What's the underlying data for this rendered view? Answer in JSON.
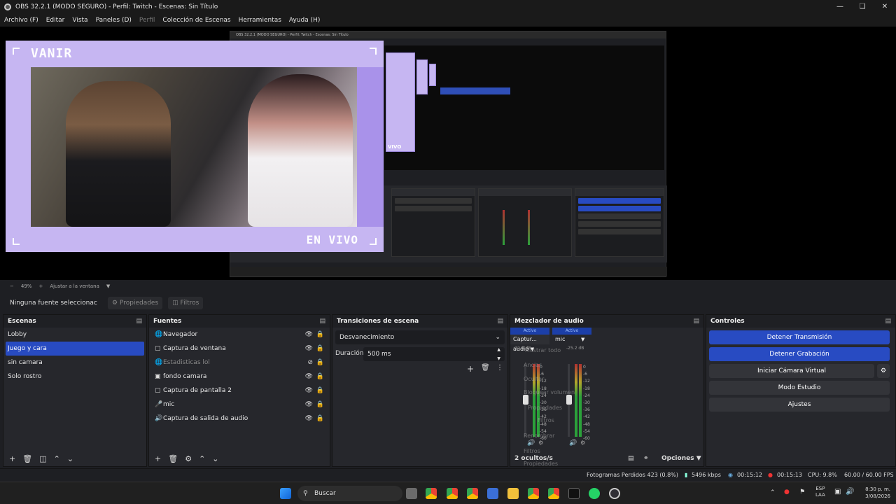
{
  "window": {
    "title": "OBS 32.2.1 (MODO SEGURO) - Perfil: Twitch - Escenas: Sin Título"
  },
  "menu": [
    "Archivo (F)",
    "Editar",
    "Vista",
    "Paneles (D)",
    "Perfil",
    "Colección de Escenas",
    "Herramientas",
    "Ayuda (H)"
  ],
  "overlay": {
    "title": "VANIR",
    "live": "EN VIVO"
  },
  "inner": {
    "title": "OBS 32.2.1 (MODO SEGURO) - Perfil: Twitch - Escenas: Sin Título",
    "echo_label": "VIVO"
  },
  "zoom": {
    "minus": "−",
    "value": "49%",
    "plus": "+",
    "fit": "Ajustar a la ventana"
  },
  "sourcebar": {
    "none": "Ninguna fuente seleccionac",
    "properties": "Propiedades",
    "filters": "Filtros"
  },
  "scenes": {
    "title": "Escenas",
    "items": [
      "Lobby",
      "Juego y cara",
      "sin camara",
      "Solo rostro"
    ]
  },
  "sources": {
    "title": "Fuentes",
    "items": [
      "Navegador",
      "Captura de ventana",
      "Estadisticas lol",
      "fondo camara",
      "Captura de pantalla 2",
      "mic",
      "Captura de salida de audio"
    ]
  },
  "transitions": {
    "title": "Transiciones de escena",
    "type": "Desvanecimiento",
    "duration_label": "Duración",
    "duration": "500 ms"
  },
  "mixer": {
    "title": "Mezclador de audio",
    "channels": [
      {
        "status": "Activo",
        "name": "Captur... audio",
        "db": "-22.8 dB"
      },
      {
        "status": "Activo",
        "name": "mic",
        "db": "-25.2 dB"
      }
    ],
    "scale": [
      "0",
      "-6",
      "-12",
      "-18",
      "-24",
      "-30",
      "-36",
      "-42",
      "-48",
      "-54",
      "-60"
    ],
    "hidden": "2 ocultos/s",
    "options": "Opciones",
    "ctx": [
      "Mostrar todo",
      "Anclar",
      "Ocultar",
      "Bloquear volumen",
      "Propiedades",
      "Filtros",
      "Renombrar",
      "Filtros",
      "Propiedades"
    ]
  },
  "controls": {
    "title": "Controles",
    "buttons": [
      "Detener Transmisión",
      "Detener Grabación",
      "Iniciar Cámara Virtual",
      "Modo Estudio",
      "Ajustes"
    ]
  },
  "status": {
    "dropped": "Fotogramas Perdidos 423 (0.8%)",
    "bitrate": "5496 kbps",
    "stream_time": "00:15:12",
    "rec_time": "00:15:13",
    "cpu": "CPU: 9.8%",
    "fps": "60.00 / 60.00 FPS"
  },
  "taskbar": {
    "search": "Buscar",
    "lang1": "ESP",
    "lang2": "LAA",
    "time": "8:30 p. m.",
    "date": "3/08/2026"
  },
  "colors": {
    "accent": "#284bc2",
    "overlay": "#c6b6f2"
  }
}
